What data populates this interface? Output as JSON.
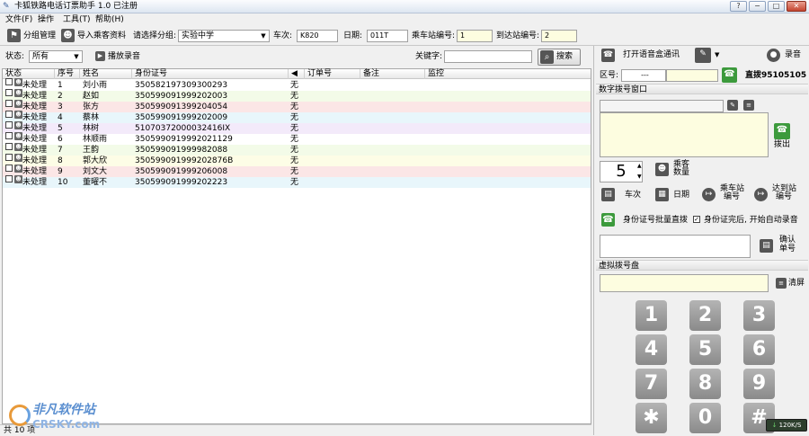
{
  "window": {
    "title": "卡狐铁路电话订票助手 1.0 已注册",
    "controls": {
      "help": "?",
      "minimize": "−",
      "maximize": "□",
      "close": "✕"
    }
  },
  "menu": [
    "文件(F)",
    "操作",
    "工具(T)",
    "帮助(H)"
  ],
  "toolbar": {
    "group_manage": "分组管理",
    "import_passengers": "导入乘客资料",
    "select_group_label": "请选择分组:",
    "group_value": "实验中学",
    "train_label": "车次:",
    "train_value": "K820",
    "date_label": "日期:",
    "date_value": "011T",
    "board_label": "乘车站编号:",
    "board_value": "1",
    "arrive_label": "到达站编号:",
    "arrive_value": "2"
  },
  "filter": {
    "status_label": "状态:",
    "status_value": "所有",
    "play_record": "播放录音",
    "keyword_label": "关键字:",
    "keyword_value": "",
    "search": "搜索"
  },
  "grid": {
    "columns": [
      "状态",
      "序号",
      "姓名",
      "身份证号",
      "",
      "订单号",
      "备注",
      "监控"
    ],
    "rows": [
      {
        "status": "未处理",
        "no": "1",
        "name": "刘小雨",
        "id": "350582197309300293",
        "flag": "无",
        "bg": "#ffffff"
      },
      {
        "status": "未处理",
        "no": "2",
        "name": "赵如",
        "id": "350599091999202003",
        "flag": "无",
        "bg": "#f3fbe8"
      },
      {
        "status": "未处理",
        "no": "3",
        "name": "张方",
        "id": "350599091399204054",
        "flag": "无",
        "bg": "#fbe6e6"
      },
      {
        "status": "未处理",
        "no": "4",
        "name": "蔡林",
        "id": "350599091999202009",
        "flag": "无",
        "bg": "#e8f6fb"
      },
      {
        "status": "未处理",
        "no": "5",
        "name": "林树",
        "id": "51070372000032416IX",
        "flag": "无",
        "bg": "#f3eafa"
      },
      {
        "status": "未处理",
        "no": "6",
        "name": "林顺雨",
        "id": "3505990919992021129",
        "flag": "无",
        "bg": "#ffffff"
      },
      {
        "status": "未处理",
        "no": "7",
        "name": "王韵",
        "id": "350599091999982088",
        "flag": "无",
        "bg": "#f3fbe8"
      },
      {
        "status": "未处理",
        "no": "8",
        "name": "郭大欣",
        "id": "350599091999202876B",
        "flag": "无",
        "bg": "#fdfde6"
      },
      {
        "status": "未处理",
        "no": "9",
        "name": "刘文大",
        "id": "350599091999206008",
        "flag": "无",
        "bg": "#fbe6e6"
      },
      {
        "status": "未处理",
        "no": "10",
        "name": "董曜不",
        "id": "350599091999202223",
        "flag": "无",
        "bg": "#e8f6fb"
      }
    ]
  },
  "status_bar": "共 10 项",
  "right": {
    "open_voice": "打开语音盒通讯",
    "record": "录音",
    "area_label": "区号:",
    "area_value": "---",
    "direct_dial": "直拨95105105",
    "digital_window": "数字拨号窗口",
    "hangup": "拨出",
    "count_value": "5",
    "count_label_1": "乘客",
    "count_label_2": "数量",
    "train_btn": "车次",
    "date_btn": "日期",
    "board_btn_1": "乘车站",
    "board_btn_2": "编号",
    "arrive_btn_1": "达到站",
    "arrive_btn_2": "编号",
    "batch_dial": "身份证号批量直拨",
    "auto_record_label": "身份证完后, 开始自动录音",
    "confirm_1": "确认",
    "confirm_2": "单号",
    "virtual_pad": "虚拟拨号盘",
    "clear": "清屏",
    "keys": [
      "1",
      "2",
      "3",
      "4",
      "5",
      "6",
      "7",
      "8",
      "9",
      "✱",
      "0",
      "#"
    ]
  },
  "speed": "120K/S",
  "watermark": {
    "line1": "非凡软件站",
    "line2": "CRSKY.com"
  }
}
